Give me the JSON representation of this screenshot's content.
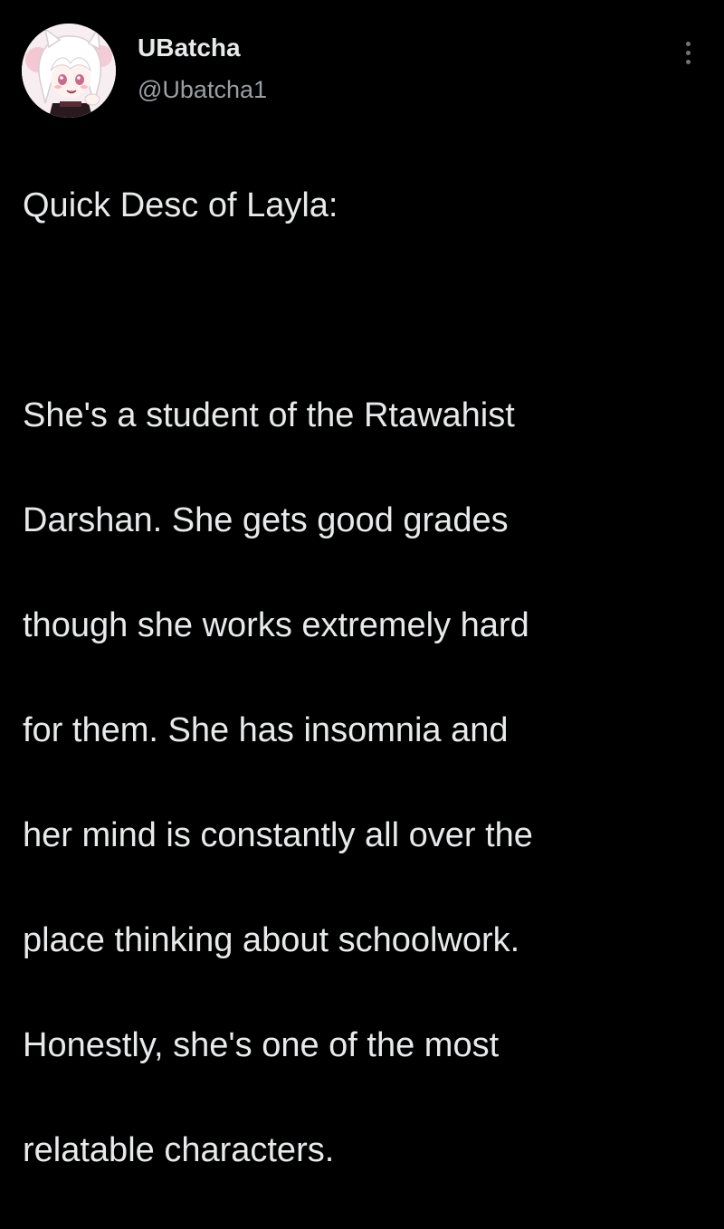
{
  "author": {
    "display_name": "UBatcha",
    "handle": "@Ubatcha1",
    "avatar_icon": "anime-character-avatar"
  },
  "more_button": {
    "icon": "more-vertical-icon"
  },
  "tweet": {
    "lines": [
      "Quick Desc of Layla:",
      "",
      "She's a student of the Rtawahist",
      "Darshan. She gets good grades",
      "though she works extremely hard",
      "for them. She has insomnia and",
      "her mind is constantly all over the",
      "place thinking about schoolwork.",
      "Honestly, she's one of the most",
      "relatable characters."
    ]
  },
  "colors": {
    "background": "#000000",
    "primary_text": "#e7e9ea",
    "secondary_text": "#9a9fa5"
  }
}
